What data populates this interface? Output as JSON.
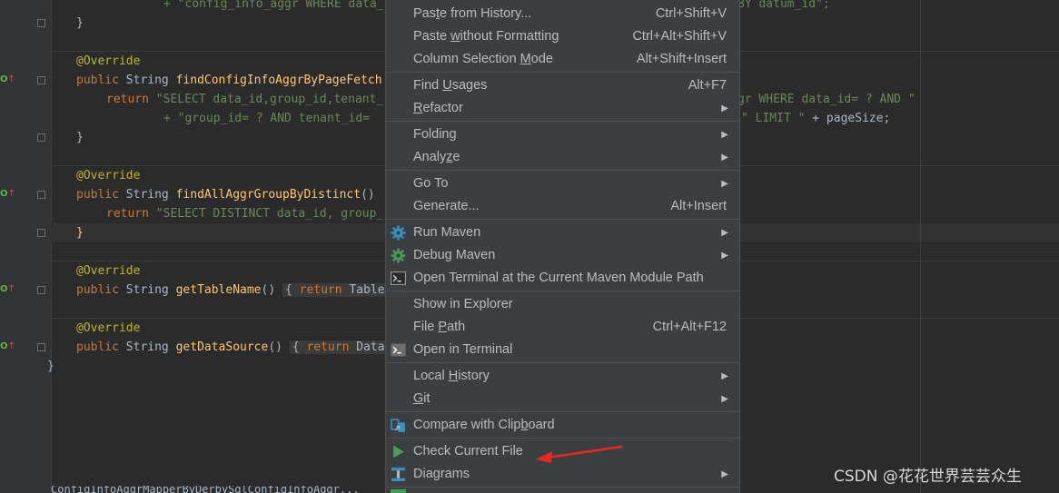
{
  "code": {
    "line1_str": "+ \"config_info_aggr WHERE data_",
    "line1_right": "BY datum_id\";",
    "close_brace": "}",
    "override": "@Override",
    "m1_sig_kw": "public",
    "m1_sig_type": "String",
    "m1_name": "findConfigInfoAggrByPageFetch",
    "m1_return_kw": "return",
    "m1_return_str": "\"SELECT data_id,group_id,tenant_",
    "m1_return_right": "gr WHERE data_id= ? AND \"",
    "m1_line2_str": "+ \"group_id= ? AND tenant_id=",
    "m1_line2_right_str": "\" LIMIT \"",
    "m1_line2_right_tail": " + pageSize;",
    "m2_name": "findAllAggrGroupByDistinct",
    "m2_parens": "()",
    "m2_return_str": "\"SELECT DISTINCT data_id, group_",
    "m3_name": "getTableName",
    "m3_tail_kw": "return",
    "m3_tail": " Table",
    "m4_name": "getDataSource",
    "m4_tail_kw": "return",
    "m4_tail": " Data",
    "class_close": "}",
    "bottom_partial": "ConfigInfoAggrMapperByDerbySqlConfigInfoAggr..."
  },
  "menu": {
    "items": [
      {
        "label": "Paste from History...",
        "shortcut": "Ctrl+Shift+V"
      },
      {
        "label": "Paste without Formatting",
        "shortcut": "Ctrl+Alt+Shift+V"
      },
      {
        "label": "Column Selection Mode",
        "shortcut": "Alt+Shift+Insert"
      },
      {
        "label": "Find Usages",
        "shortcut": "Alt+F7"
      },
      {
        "label": "Refactor",
        "shortcut": ""
      },
      {
        "label": "Folding",
        "shortcut": ""
      },
      {
        "label": "Analyze",
        "shortcut": ""
      },
      {
        "label": "Go To",
        "shortcut": ""
      },
      {
        "label": "Generate...",
        "shortcut": "Alt+Insert"
      },
      {
        "label": "Run Maven",
        "shortcut": ""
      },
      {
        "label": "Debug Maven",
        "shortcut": ""
      },
      {
        "label": "Open Terminal at the Current Maven Module Path",
        "shortcut": ""
      },
      {
        "label": "Show in Explorer",
        "shortcut": ""
      },
      {
        "label": "File Path",
        "shortcut": "Ctrl+Alt+F12"
      },
      {
        "label": "Open in Terminal",
        "shortcut": ""
      },
      {
        "label": "Local History",
        "shortcut": ""
      },
      {
        "label": "Git",
        "shortcut": ""
      },
      {
        "label": "Compare with Clipboard",
        "shortcut": ""
      },
      {
        "label": "Check Current File",
        "shortcut": ""
      },
      {
        "label": "Diagrams",
        "shortcut": ""
      }
    ]
  },
  "watermark": "CSDN @花花世界芸芸众生",
  "colors": {
    "editor_bg": "#2b2b2b",
    "menu_bg": "#3c3f41",
    "keyword": "#cc7832",
    "annotation": "#bbb529",
    "method": "#ffc66d",
    "string": "#6a8759",
    "arrow_red": "#e8291c"
  }
}
